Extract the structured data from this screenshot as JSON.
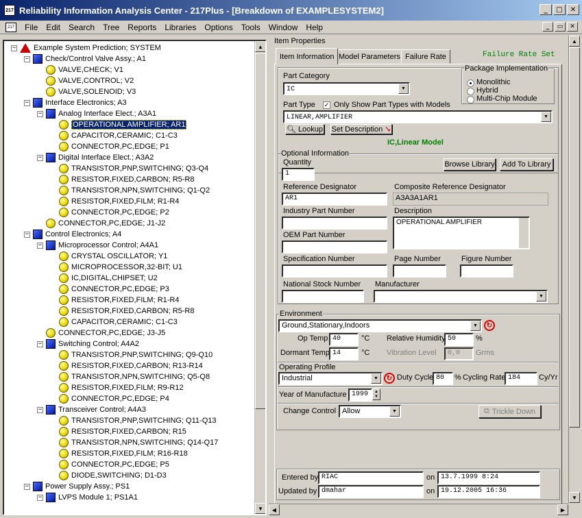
{
  "window": {
    "title": "Reliability Information Analysis Center - 217Plus - [Breakdown of EXAMPLESYSTEM2]",
    "icon_label": "217",
    "controls": [
      "_",
      "□",
      "✕"
    ]
  },
  "menu": {
    "items": [
      "File",
      "Edit",
      "Search",
      "Tree",
      "Reports",
      "Libraries",
      "Options",
      "Tools",
      "Window",
      "Help"
    ],
    "mdi_controls": [
      "_",
      "▭",
      "✕"
    ]
  },
  "tree": {
    "nodes": [
      {
        "label": "Example System Prediction; SYSTEM",
        "level": 0,
        "icon": "system-triangle-icon",
        "expander": "-"
      },
      {
        "label": "Check/Control Valve Assy.; A1",
        "level": 1,
        "icon": "assembly-cube-icon",
        "expander": "-"
      },
      {
        "label": "VALVE,CHECK; V1",
        "level": 2,
        "icon": "part-ball-icon"
      },
      {
        "label": "VALVE,CONTROL; V2",
        "level": 2,
        "icon": "part-ball-icon"
      },
      {
        "label": "VALVE,SOLENOID; V3",
        "level": 2,
        "icon": "part-ball-icon"
      },
      {
        "label": "Interface Electronics; A3",
        "level": 1,
        "icon": "assembly-cube-icon",
        "expander": "-"
      },
      {
        "label": "Analog Interface Elect.; A3A1",
        "level": 2,
        "icon": "assembly-cube-icon",
        "expander": "-"
      },
      {
        "label": "OPERATIONAL AMPLIFIER; AR1",
        "level": 3,
        "icon": "part-ball-icon",
        "selected": true
      },
      {
        "label": "CAPACITOR,CERAMIC; C1-C3",
        "level": 3,
        "icon": "part-ball-icon"
      },
      {
        "label": "CONNECTOR,PC,EDGE; P1",
        "level": 3,
        "icon": "part-ball-icon"
      },
      {
        "label": "Digital Interface Elect.; A3A2",
        "level": 2,
        "icon": "assembly-cube-icon",
        "expander": "-"
      },
      {
        "label": "TRANSISTOR,PNP,SWITCHING; Q3-Q4",
        "level": 3,
        "icon": "part-ball-icon"
      },
      {
        "label": "RESISTOR,FIXED,CARBON; R5-R8",
        "level": 3,
        "icon": "part-ball-icon"
      },
      {
        "label": "TRANSISTOR,NPN,SWITCHING; Q1-Q2",
        "level": 3,
        "icon": "part-ball-icon"
      },
      {
        "label": "RESISTOR,FIXED,FILM; R1-R4",
        "level": 3,
        "icon": "part-ball-icon"
      },
      {
        "label": "CONNECTOR,PC,EDGE; P2",
        "level": 3,
        "icon": "part-ball-icon"
      },
      {
        "label": "CONNECTOR,PC,EDGE; J1-J2",
        "level": 2,
        "icon": "part-ball-icon"
      },
      {
        "label": "Control Electronics; A4",
        "level": 1,
        "icon": "assembly-cube-icon",
        "expander": "-"
      },
      {
        "label": "Microprocessor Control; A4A1",
        "level": 2,
        "icon": "assembly-cube-icon",
        "expander": "-"
      },
      {
        "label": "CRYSTAL OSCILLATOR; Y1",
        "level": 3,
        "icon": "part-ball-icon"
      },
      {
        "label": "MICROPROCESSOR,32-BIT; U1",
        "level": 3,
        "icon": "part-ball-icon"
      },
      {
        "label": "IC,DIGITAL,CHIPSET; U2",
        "level": 3,
        "icon": "part-ball-icon"
      },
      {
        "label": "CONNECTOR,PC,EDGE; P3",
        "level": 3,
        "icon": "part-ball-icon"
      },
      {
        "label": "RESISTOR,FIXED,FILM; R1-R4",
        "level": 3,
        "icon": "part-ball-icon"
      },
      {
        "label": "RESISTOR,FIXED,CARBON; R5-R8",
        "level": 3,
        "icon": "part-ball-icon"
      },
      {
        "label": "CAPACITOR,CERAMIC; C1-C3",
        "level": 3,
        "icon": "part-ball-icon"
      },
      {
        "label": "CONNECTOR,PC,EDGE; J3-J5",
        "level": 2,
        "icon": "part-ball-icon"
      },
      {
        "label": "Switching Control; A4A2",
        "level": 2,
        "icon": "assembly-cube-icon",
        "expander": "-"
      },
      {
        "label": "TRANSISTOR,PNP,SWITCHING; Q9-Q10",
        "level": 3,
        "icon": "part-ball-icon"
      },
      {
        "label": "RESISTOR,FIXED,CARBON; R13-R14",
        "level": 3,
        "icon": "part-ball-icon"
      },
      {
        "label": "TRANSISTOR,NPN,SWITCHING; Q5-Q8",
        "level": 3,
        "icon": "part-ball-icon"
      },
      {
        "label": "RESISTOR,FIXED,FILM; R9-R12",
        "level": 3,
        "icon": "part-ball-icon"
      },
      {
        "label": "CONNECTOR,PC,EDGE; P4",
        "level": 3,
        "icon": "part-ball-icon"
      },
      {
        "label": "Transceiver Control; A4A3",
        "level": 2,
        "icon": "assembly-cube-icon",
        "expander": "-"
      },
      {
        "label": "TRANSISTOR,PNP,SWITCHING; Q11-Q13",
        "level": 3,
        "icon": "part-ball-icon"
      },
      {
        "label": "RESISTOR,FIXED,CARBON; R15",
        "level": 3,
        "icon": "part-ball-icon"
      },
      {
        "label": "TRANSISTOR,NPN,SWITCHING; Q14-Q17",
        "level": 3,
        "icon": "part-ball-icon"
      },
      {
        "label": "RESISTOR,FIXED,FILM; R16-R18",
        "level": 3,
        "icon": "part-ball-icon"
      },
      {
        "label": "CONNECTOR,PC,EDGE; P5",
        "level": 3,
        "icon": "part-ball-icon"
      },
      {
        "label": "DIODE,SWITCHING; D1-D3",
        "level": 3,
        "icon": "part-ball-icon"
      },
      {
        "label": "Power Supply Assy.; PS1",
        "level": 1,
        "icon": "assembly-cube-icon",
        "expander": "-"
      },
      {
        "label": "LVPS Module 1; PS1A1",
        "level": 2,
        "icon": "assembly-cube-icon",
        "expander": "-"
      }
    ]
  },
  "props": {
    "header": "Item Properties",
    "tabs": [
      "Item Information",
      "Model Parameters",
      "Failure Rate"
    ],
    "failure_rate_set": "Failure Rate Set",
    "part_category_label": "Part Category",
    "part_category": "IC",
    "package_label": "Package Implementation",
    "package_options": [
      "Monolithic",
      "Hybrid",
      "Multi-Chip Module"
    ],
    "part_type_label": "Part Type",
    "only_show_label": "Only Show Part Types with Models",
    "part_type": "LINEAR,AMPLIFIER",
    "lookup_label": "Lookup",
    "set_desc_label": "Set Description",
    "model_label": "IC,Linear Model",
    "optional_label": "Optional Information",
    "quantity_label": "Quantity",
    "quantity": "1",
    "browse_label": "Browse Library",
    "add_label": "Add To Library",
    "refdes_label": "Reference Designator",
    "refdes": "AR1",
    "comp_refdes_label": "Composite Reference Designator",
    "comp_refdes": "A3A3A1AR1",
    "industry_label": "Industry Part Number",
    "industry": "",
    "desc_label": "Description",
    "desc": "OPERATIONAL AMPLIFIER",
    "oem_label": "OEM Part Number",
    "oem": "",
    "spec_label": "Specification Number",
    "spec": "",
    "page_label": "Page Number",
    "page": "",
    "figure_label": "Figure Number",
    "figure": "",
    "nsn_label": "National Stock Number",
    "nsn": "",
    "mfr_label": "Manufacturer",
    "mfr": "",
    "env_label": "Environment",
    "env": "Ground,Stationary,Indoors",
    "optemp_label": "Op Temp",
    "optemp": "40",
    "unit_c": "°C",
    "rh_label": "Relative Humidity",
    "rh": "50",
    "unit_pct": "%",
    "dtemp_label": "Dormant Temp",
    "dtemp": "14",
    "vib_label": "Vibration Level",
    "vib": "0,0",
    "unit_grms": "Grms",
    "opprof_label": "Operating Profile",
    "opprof": "Industrial",
    "duty_label": "Duty Cycle",
    "duty": "80",
    "cyc_label": "Cycling Rate",
    "cyc": "184",
    "unit_cy": "Cy/Yr",
    "year_label": "Year of Manufacture",
    "year": "1999",
    "change_label": "Change Control",
    "change": "Allow",
    "trickle_label": "Trickle Down",
    "entered_label": "Entered by",
    "entered": "RIAC",
    "on_label": "on",
    "entered_on": "13.7.1999 8:24",
    "updated_label": "Updated by",
    "updated": "dmahar",
    "updated_on": "19.12.2005 16:36"
  }
}
